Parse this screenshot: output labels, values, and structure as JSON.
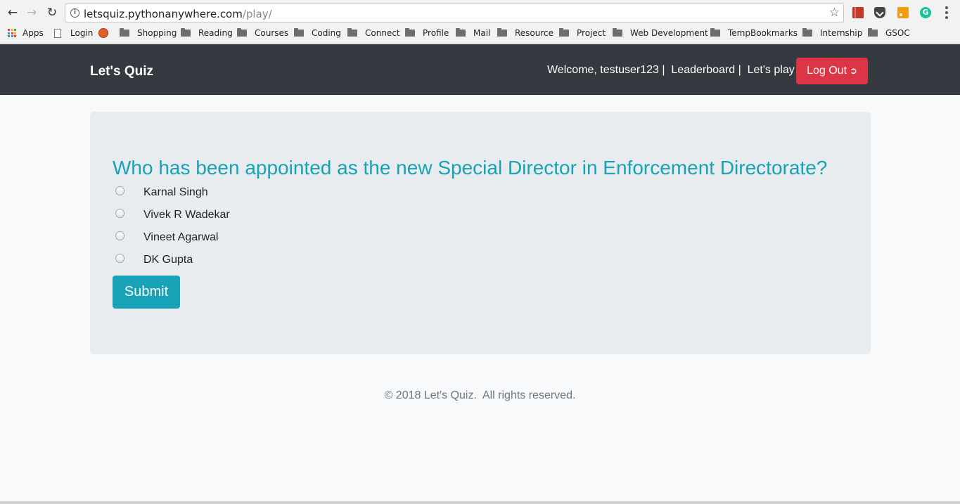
{
  "browser": {
    "url_host": "letsquiz.pythonanywhere.com",
    "url_path": "/play/",
    "back_icon": "arrow-left-icon",
    "forward_icon": "arrow-right-icon",
    "reload_icon": "reload-icon",
    "star_icon": "star-icon",
    "extensions": [
      "book-icon",
      "pocket-icon",
      "rss-icon",
      "grammarly-icon"
    ],
    "grammarly_letter": "G",
    "bookmarks": [
      {
        "label": "Apps",
        "icon": "apps-grid-icon"
      },
      {
        "label": "Login",
        "icon": "page-icon"
      },
      {
        "label": "",
        "icon": "extension-icon"
      },
      {
        "label": "Shopping",
        "icon": "folder-icon"
      },
      {
        "label": "Reading",
        "icon": "folder-icon"
      },
      {
        "label": "Courses",
        "icon": "folder-icon"
      },
      {
        "label": "Coding",
        "icon": "folder-icon"
      },
      {
        "label": "Connect",
        "icon": "folder-icon"
      },
      {
        "label": "Profile",
        "icon": "folder-icon"
      },
      {
        "label": "Mail",
        "icon": "folder-icon"
      },
      {
        "label": "Resource",
        "icon": "folder-icon"
      },
      {
        "label": "Project",
        "icon": "folder-icon"
      },
      {
        "label": "Web Development",
        "icon": "folder-icon"
      },
      {
        "label": "TempBookmarks",
        "icon": "folder-icon"
      },
      {
        "label": "Internship",
        "icon": "folder-icon"
      },
      {
        "label": "GSOC",
        "icon": "folder-icon"
      }
    ]
  },
  "navbar": {
    "brand": "Let's Quiz",
    "welcome": "Welcome, testuser123 |",
    "leaderboard": "Leaderboard |",
    "lets_play": "Let's play",
    "logout_label": "Log Out",
    "logout_icon": "sign-out-icon"
  },
  "quiz": {
    "question": "Who has been appointed as the new Special Director in Enforcement Directorate?",
    "options": [
      "Karnal Singh",
      "Vivek R Wadekar",
      "Vineet Agarwal",
      "DK Gupta"
    ],
    "submit_label": "Submit"
  },
  "footer": {
    "text": "© 2018 Let's Quiz.  All rights reserved."
  },
  "colors": {
    "navbar_bg": "#343a40",
    "logout_btn": "#dc3545",
    "accent": "#17a2b8",
    "card_bg": "#e9ecef",
    "page_bg": "#f8f9fa"
  }
}
